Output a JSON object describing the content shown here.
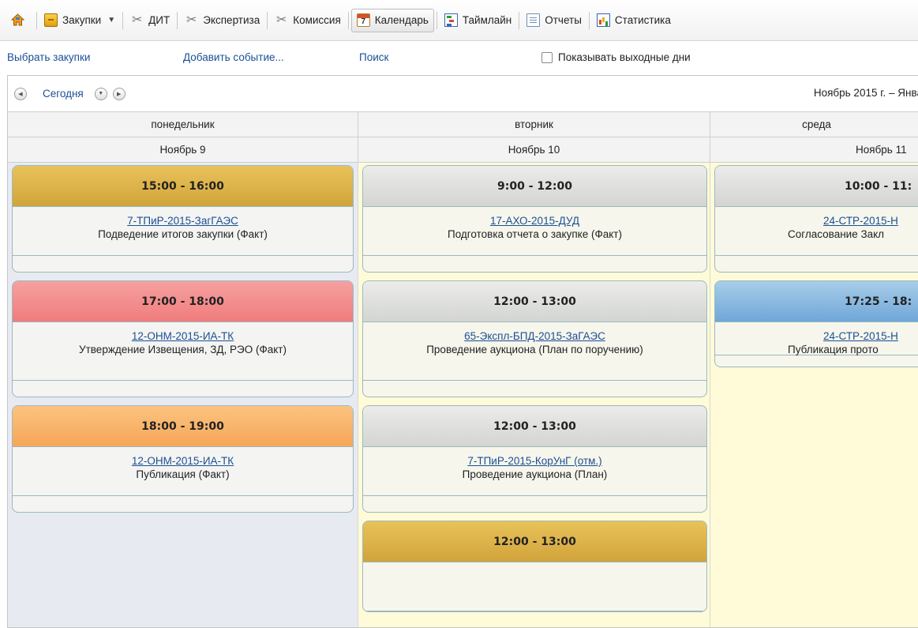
{
  "menu": {
    "home_icon": "home-icon",
    "items": [
      {
        "label": "Закупки",
        "icon": "briefcase-icon"
      },
      {
        "label": "ДИТ",
        "icon": "tools-icon"
      },
      {
        "label": "Экспертиза",
        "icon": "tools-icon"
      },
      {
        "label": "Комиссия",
        "icon": "tools-icon"
      },
      {
        "label": "Календарь",
        "icon": "calendar-icon",
        "active": true
      },
      {
        "label": "Таймлайн",
        "icon": "timeline-icon"
      },
      {
        "label": "Отчеты",
        "icon": "report-icon"
      },
      {
        "label": "Статистика",
        "icon": "stats-icon"
      }
    ],
    "dropdown_glyph": "▼"
  },
  "actions": {
    "select_purchases": "Выбрать закупки",
    "add_event": "Добавить событие...",
    "search": "Поиск",
    "show_weekends": "Показывать выходные дни"
  },
  "calendar_nav": {
    "today": "Сегодня",
    "range": "Ноябрь 2015 г. – Янва"
  },
  "days": [
    {
      "name": "понедельник",
      "date": "Ноябрь 9"
    },
    {
      "name": "вторник",
      "date": "Ноябрь 10"
    },
    {
      "name": "среда",
      "date": "Ноябрь 11"
    }
  ],
  "events": {
    "monday": [
      {
        "time": "15:00 - 16:00",
        "code": "7-ТПиР-2015-ЗагГАЭС",
        "desc": "Подведение итогов закупки (Факт)",
        "color": "#d1a43b"
      },
      {
        "time": "17:00 - 18:00",
        "code": "12-ОНМ-2015-ИА-ТК",
        "desc": "Утверждение Извещения, ЗД, РЭО (Факт)",
        "color": "#f07c7c"
      },
      {
        "time": "18:00 - 19:00",
        "code": "12-ОНМ-2015-ИА-ТК",
        "desc": "Публикация (Факт)",
        "color": "#f6a658"
      }
    ],
    "tuesday": [
      {
        "time": "9:00 - 12:00",
        "code": "17-АХО-2015-ДУД",
        "desc": "Подготовка отчета о закупке (Факт)",
        "color": "#d3d5d2"
      },
      {
        "time": "12:00 - 13:00",
        "code": "65-Экспл-БПД-2015-ЗаГАЭС",
        "desc": "Проведение аукциона (План по поручению)",
        "color": "#d3d5d2"
      },
      {
        "time": "12:00 - 13:00",
        "code": "7-ТПиР-2015-КорУнГ (отм.)",
        "desc": "Проведение аукциона (План)",
        "color": "#d3d5d2"
      },
      {
        "time": "12:00 - 13:00",
        "color": "#d1a43b"
      }
    ],
    "wednesday": [
      {
        "time": "10:00 - 11:",
        "code": "24-СТР-2015-Н",
        "desc": "Согласование Закл",
        "color": "#d3d5d2"
      },
      {
        "time": "17:25 - 18:",
        "code": "24-СТР-2015-Н",
        "desc": "Публикация прото",
        "color": "#6fa7d8"
      }
    ]
  }
}
